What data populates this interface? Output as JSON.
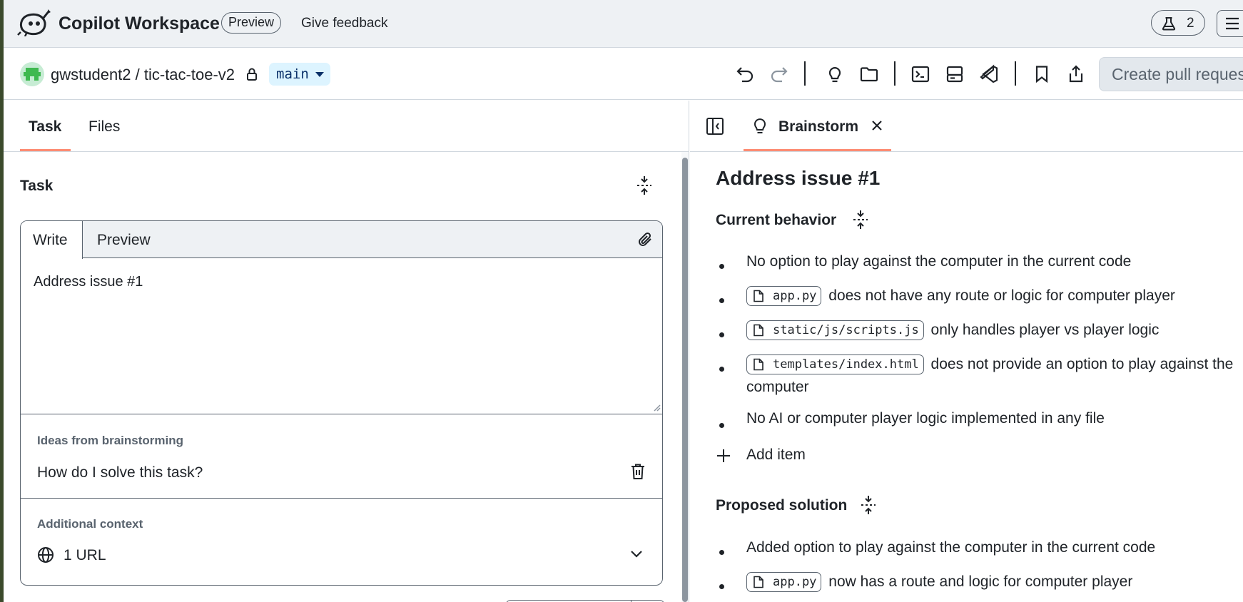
{
  "header": {
    "app_title": "Copilot Workspace",
    "preview_badge": "Preview",
    "feedback_link": "Give feedback",
    "lab_count": "2",
    "icons": [
      "copilot-logo",
      "beaker-icon",
      "hamburger-menu-icon"
    ]
  },
  "repo": {
    "name": "gwstudent2 / tic-tac-toe-v2",
    "branch": "main",
    "create_pr_label": "Create pull request",
    "toolbar_icons": [
      "undo-icon",
      "redo-icon",
      "lightbulb-icon",
      "folder-icon",
      "terminal-icon",
      "server-icon",
      "vscode-icon",
      "bookmark-icon",
      "share-icon"
    ]
  },
  "left": {
    "tabs": [
      "Task",
      "Files"
    ],
    "active_tab": "Task",
    "task_heading": "Task",
    "editor": {
      "write_tab": "Write",
      "preview_tab": "Preview",
      "content": "Address issue #1"
    },
    "ideas": {
      "label": "Ideas from brainstorming",
      "text": "How do I solve this task?"
    },
    "context": {
      "label": "Additional context",
      "value": "1 URL"
    }
  },
  "right": {
    "tab_label": "Brainstorm",
    "title": "Address issue #1",
    "current_behavior": {
      "heading": "Current behavior",
      "items": [
        {
          "file": "",
          "text": "No option to play against the computer in the current code"
        },
        {
          "file": "app.py",
          "text": "does not have any route or logic for computer player"
        },
        {
          "file": "static/js/scripts.js",
          "text": "only handles player vs player logic"
        },
        {
          "file": "templates/index.html",
          "text": "does not provide an option to play against the computer"
        },
        {
          "file": "",
          "text": "No AI or computer player logic implemented in any file"
        }
      ],
      "add_item": "Add item"
    },
    "proposed_solution": {
      "heading": "Proposed solution",
      "items": [
        {
          "file": "",
          "text": "Added option to play against the computer in the current code"
        },
        {
          "file": "app.py",
          "text": "now has a route and logic for computer player"
        }
      ]
    }
  },
  "colors": {
    "accent_underline": "#fd8c73",
    "branch_bg": "#ddf4ff",
    "branch_text": "#0a3069",
    "header_bg": "#eef1f4"
  }
}
